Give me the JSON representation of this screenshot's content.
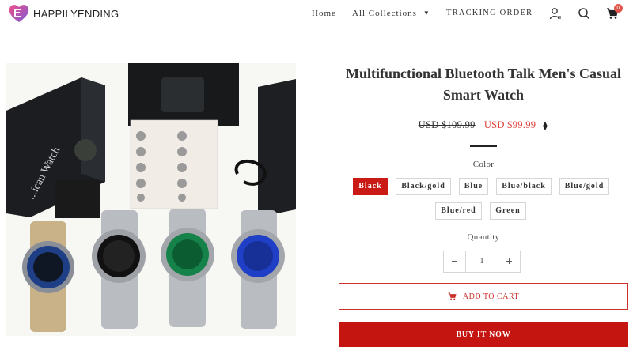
{
  "brand": {
    "name": "HAPPILYENDING",
    "colors": [
      "#e8447c",
      "#7b5bd6"
    ]
  },
  "nav": {
    "home": "Home",
    "collections": "All Collections",
    "collections_caret": "▼",
    "tracking": "TRACKING ORDER",
    "cart_count": "0"
  },
  "product": {
    "title": "Multifunctional Bluetooth Talk Men's Casual Smart Watch",
    "price_old": "USD $109.99",
    "price_new": "USD $99.99",
    "currency_toggle_icon": "sort-arrows-icon",
    "color_label": "Color",
    "colors": [
      "Black",
      "Black/gold",
      "Blue",
      "Blue/black",
      "Blue/gold",
      "Blue/red",
      "Green"
    ],
    "selected_color": "Black",
    "quantity_label": "Quantity",
    "quantity": "1",
    "minus": "−",
    "plus": "+",
    "add_to_cart": "ADD TO CART",
    "buy_now": "BUY IT NOW"
  },
  "photo": {
    "box_print": "...ican Watch"
  },
  "theme": {
    "accent": "#c41510",
    "badge": "#e2574c"
  }
}
